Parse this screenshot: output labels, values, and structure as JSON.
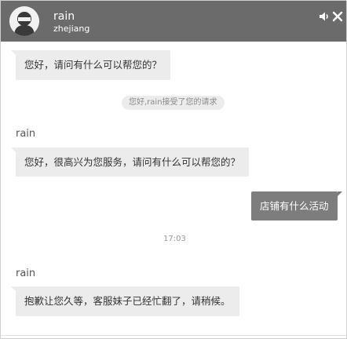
{
  "header": {
    "agent_name": "rain",
    "agent_location": "zhejiang",
    "sound_icon": "speaker-icon",
    "close_icon": "close-icon"
  },
  "messages": [
    {
      "type": "agent",
      "text": "您好，请问有什么可以帮您的？"
    },
    {
      "type": "system",
      "text": "您好,rain接受了您的请求"
    },
    {
      "type": "agent",
      "sender": "rain",
      "text": "您好，很高兴为您服务，请问有什么可以帮您的？"
    },
    {
      "type": "user",
      "text": "店铺有什么活动"
    },
    {
      "type": "time",
      "text": "17:03"
    },
    {
      "type": "agent",
      "sender": "rain",
      "text": "抱歉让您久等，客服妹子已经忙翻了，请稍候。"
    }
  ],
  "colors": {
    "header_bg": "#6b6b6b",
    "agent_bubble": "#ececec",
    "user_bubble": "#7d7d7d"
  }
}
